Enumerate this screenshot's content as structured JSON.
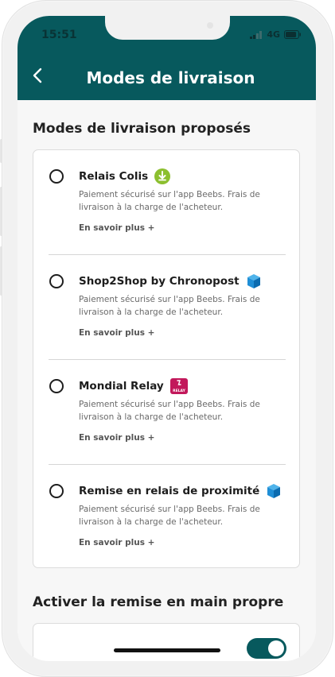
{
  "status_bar": {
    "time": "15:51",
    "network": "4G"
  },
  "header": {
    "title": "Modes de livraison"
  },
  "section1": {
    "title": "Modes de livraison proposés"
  },
  "options": [
    {
      "name": "Relais Colis",
      "icon": "relais-colis-download-icon",
      "description": "Paiement sécurisé sur l'app Beebs. Frais de livraison à la charge de l'acheteur.",
      "more": "En savoir plus +"
    },
    {
      "name": "Shop2Shop by Chronopost",
      "icon": "chronopost-box-icon",
      "description": "Paiement sécurisé sur l'app Beebs. Frais de livraison à la charge de l'acheteur.",
      "more": "En savoir plus +"
    },
    {
      "name": "Mondial Relay",
      "icon": "mondial-relay-logo-icon",
      "description": "Paiement sécurisé sur l'app Beebs. Frais de livraison à la charge de l'acheteur.",
      "more": "En savoir plus +"
    },
    {
      "name": "Remise en relais de proximité",
      "icon": "relay-box-icon",
      "description": "Paiement sécurisé sur l'app Beebs. Frais de livraison à la charge de l'acheteur.",
      "more": "En savoir plus +"
    }
  ],
  "section2": {
    "title": "Activer la remise en main propre"
  },
  "mondial_logo_text": "RELAY",
  "colors": {
    "header": "#07595d",
    "relais_green": "#8cbf2f",
    "chronopost_blue": "#1f8ed6",
    "mondial_red": "#c2185b"
  }
}
